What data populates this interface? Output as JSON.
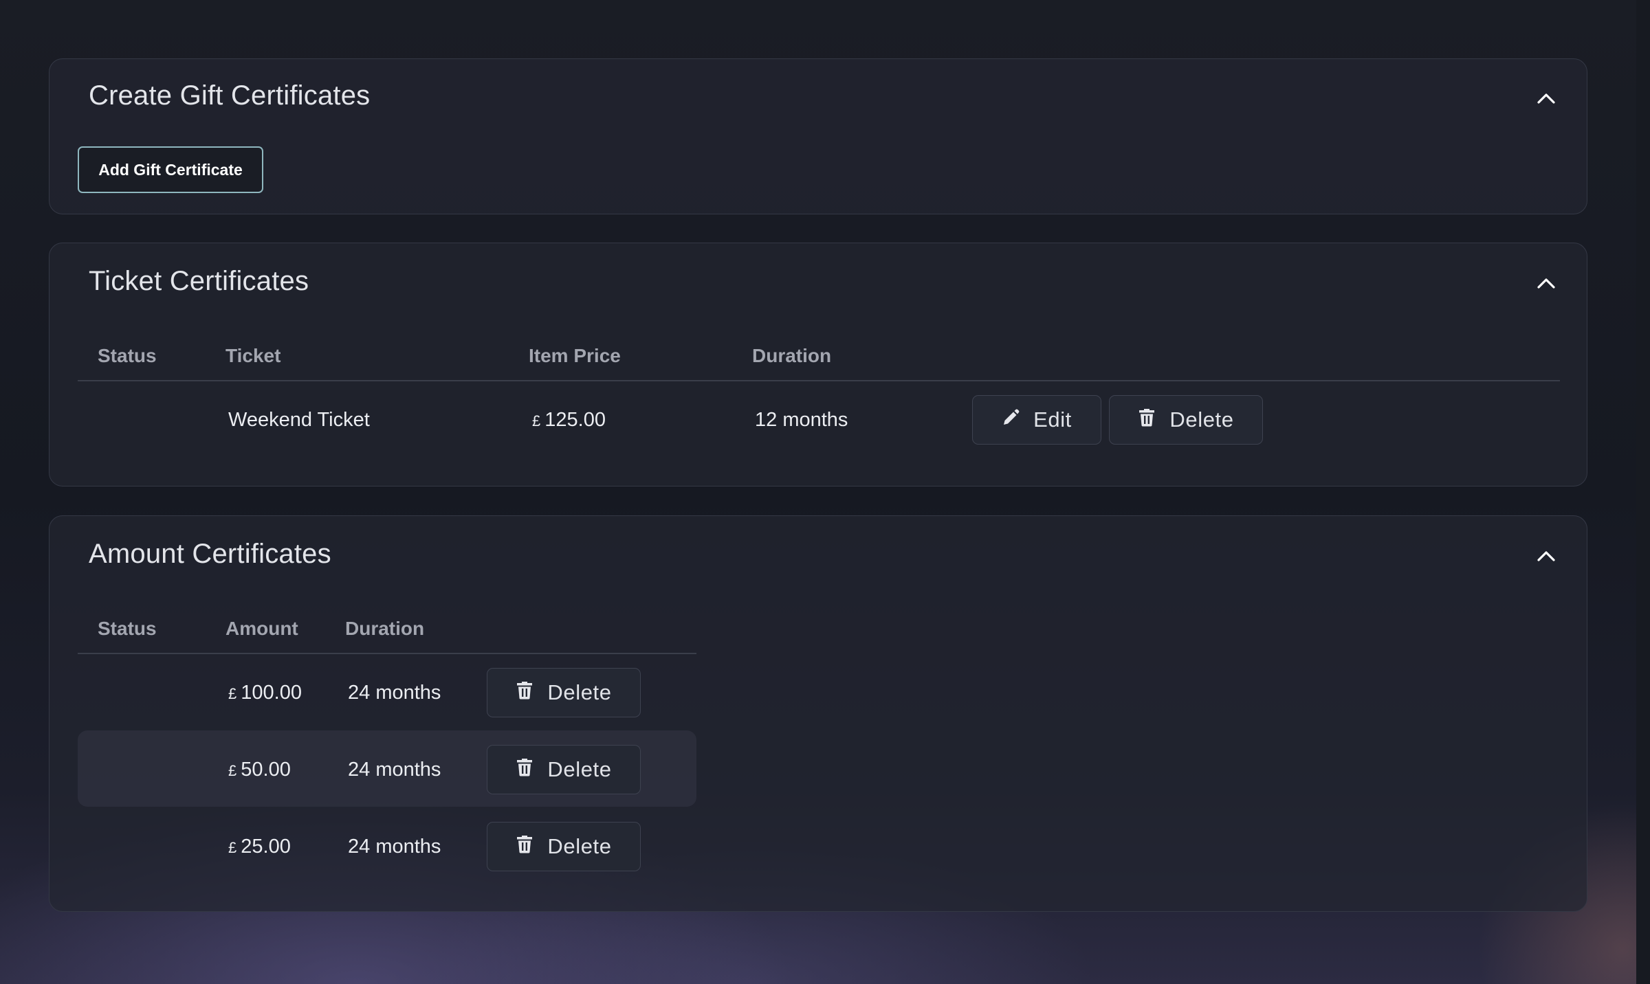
{
  "create_panel": {
    "title": "Create Gift Certificates",
    "add_button": "Add Gift Certificate",
    "chevron_icon": "chevron-up-icon"
  },
  "ticket_panel": {
    "title": "Ticket Certificates",
    "chevron_icon": "chevron-up-icon",
    "columns": [
      "Status",
      "Ticket",
      "Item Price",
      "Duration"
    ],
    "rows": [
      {
        "status": "",
        "ticket": "Weekend Ticket",
        "currency": "£",
        "price": "125.00",
        "duration": "12 months",
        "edit_label": "Edit",
        "delete_label": "Delete"
      }
    ]
  },
  "amount_panel": {
    "title": "Amount Certificates",
    "chevron_icon": "chevron-up-icon",
    "columns": [
      "Status",
      "Amount",
      "Duration"
    ],
    "rows": [
      {
        "status": "",
        "currency": "£",
        "amount": "100.00",
        "duration": "24 months",
        "delete_label": "Delete"
      },
      {
        "status": "",
        "currency": "£",
        "amount": "50.00",
        "duration": "24 months",
        "delete_label": "Delete"
      },
      {
        "status": "",
        "currency": "£",
        "amount": "25.00",
        "duration": "24 months",
        "delete_label": "Delete"
      }
    ]
  },
  "icons": {
    "edit": "pencil-icon",
    "delete": "trash-icon"
  }
}
